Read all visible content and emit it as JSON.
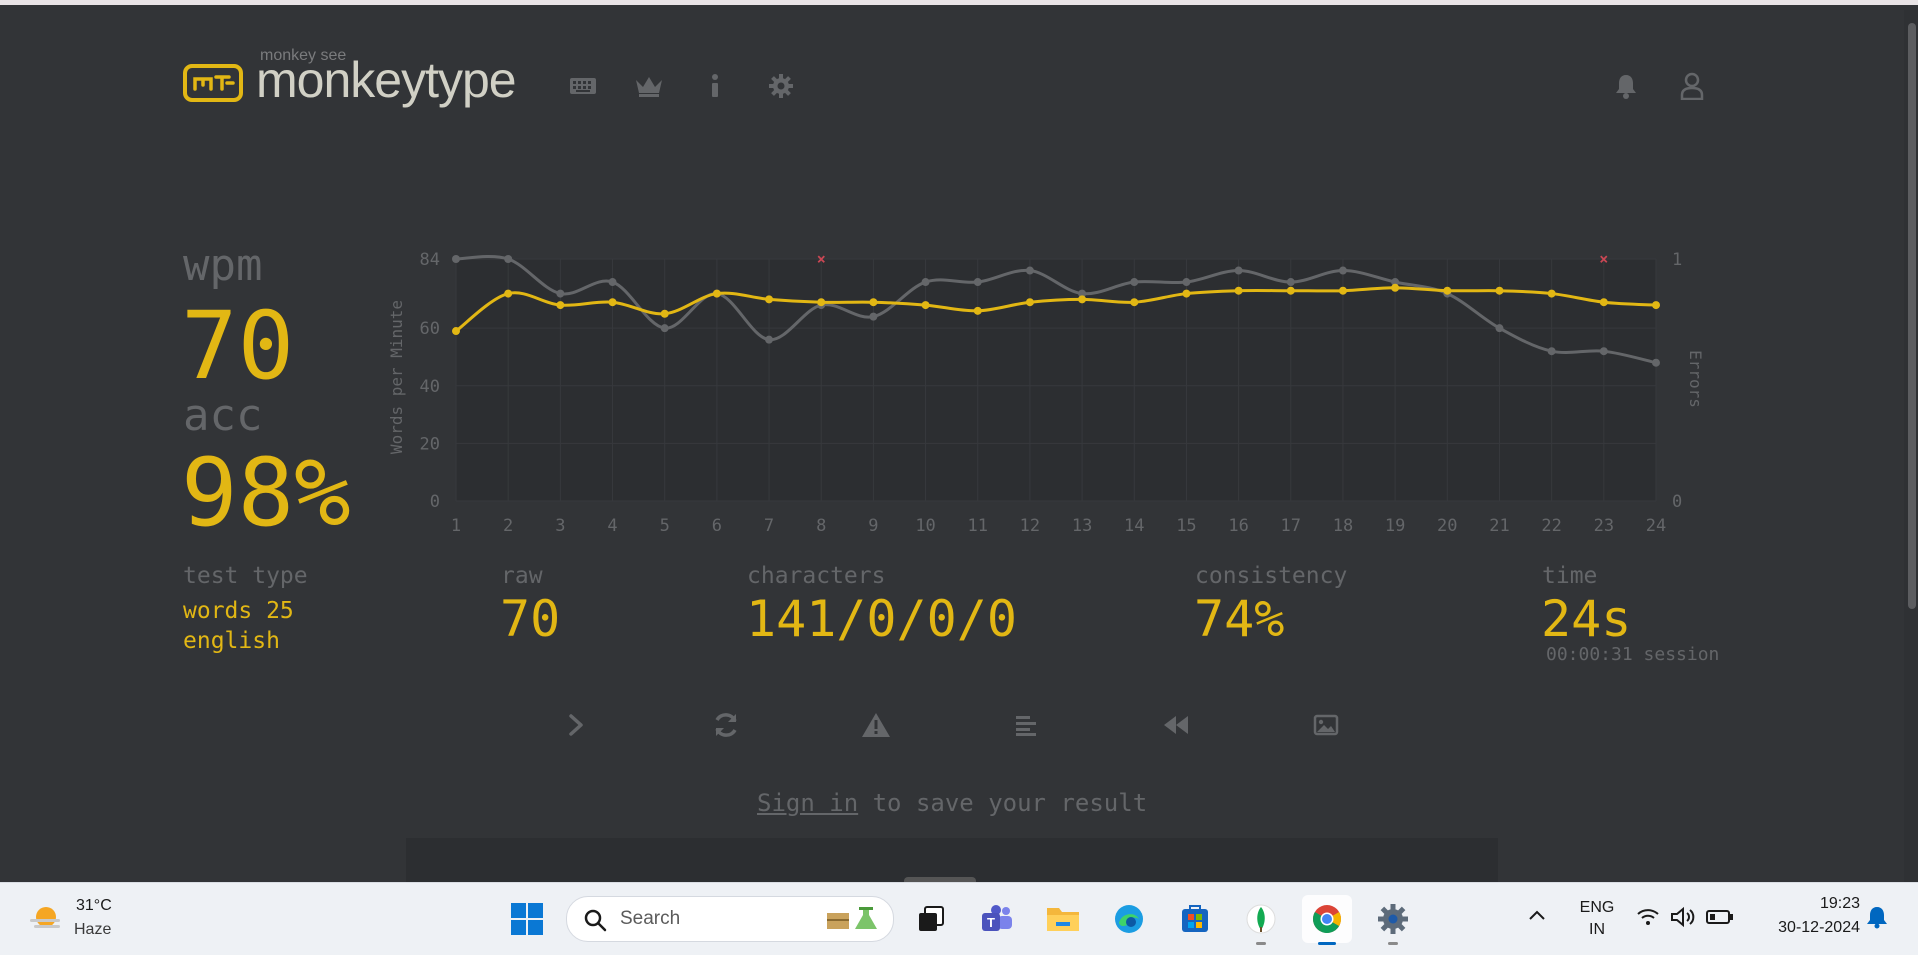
{
  "header": {
    "brand_sub": "monkey see",
    "brand": "monkeytype"
  },
  "result": {
    "wpm_label": "wpm",
    "wpm_value": "70",
    "acc_label": "acc",
    "acc_value": "98%",
    "test_type_label": "test type",
    "test_type_line1": "words 25",
    "test_type_line2": "english",
    "raw_label": "raw",
    "raw_value": "70",
    "characters_label": "characters",
    "characters_value": "141/0/0/0",
    "consistency_label": "consistency",
    "consistency_value": "74%",
    "time_label": "time",
    "time_value": "24s",
    "session_text": "00:00:31 session"
  },
  "chart_data": {
    "type": "line",
    "x": [
      1,
      2,
      3,
      4,
      5,
      6,
      7,
      8,
      9,
      10,
      11,
      12,
      13,
      14,
      15,
      16,
      17,
      18,
      19,
      20,
      21,
      22,
      23,
      24
    ],
    "ylabel": "Words per Minute",
    "y2label": "Errors",
    "ylim": [
      0,
      84
    ],
    "y2lim": [
      0,
      1
    ],
    "y_ticks": [
      "84",
      "60",
      "40",
      "20",
      "0"
    ],
    "y2_ticks": [
      "1",
      "0"
    ],
    "series": [
      {
        "values": [
          84,
          84,
          72,
          76,
          60,
          72,
          56,
          68,
          64,
          76,
          76,
          80,
          72,
          76,
          76,
          80,
          76,
          80,
          76,
          72,
          60,
          52,
          52,
          48
        ],
        "color": "#646669"
      },
      {
        "values": [
          59,
          72,
          68,
          69,
          65,
          72,
          70,
          69,
          69,
          68,
          66,
          69,
          70,
          69,
          72,
          73,
          73,
          73,
          74,
          73,
          73,
          72,
          69,
          68
        ],
        "color": "#e2b714"
      }
    ],
    "errors": [
      {
        "x": 8,
        "count": 1
      },
      {
        "x": 23,
        "count": 1
      }
    ],
    "error_color": "#ca4754",
    "grid": true
  },
  "actions": {
    "sign_in_link": "Sign in",
    "sign_in_rest": " to save your result"
  },
  "taskbar": {
    "temperature": "31°C",
    "weather": "Haze",
    "search_placeholder": "Search",
    "lang_line1": "ENG",
    "lang_line2": "IN",
    "clock_time": "19:23",
    "clock_date": "30-12-2024"
  },
  "colors": {
    "background": "#323437",
    "main": "#e2b714",
    "sub": "#646669",
    "text": "#d1d0c5",
    "error": "#ca4754"
  }
}
